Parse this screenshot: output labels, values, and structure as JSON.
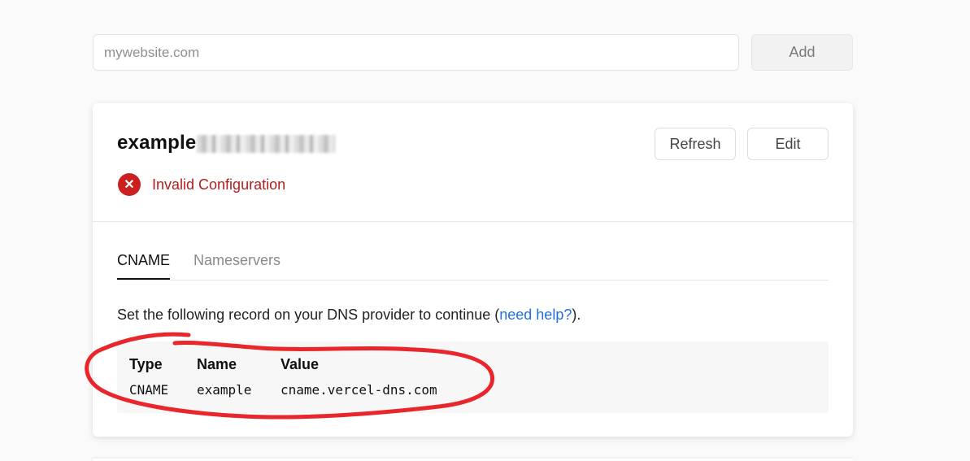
{
  "add_domain": {
    "placeholder": "mywebsite.com",
    "value": "",
    "add_label": "Add"
  },
  "domain_card": {
    "domain_prefix": "example",
    "refresh_label": "Refresh",
    "edit_label": "Edit",
    "status": {
      "icon": "x-circle-icon",
      "text": "Invalid Configuration",
      "color": "#cc1f1f"
    },
    "tabs": [
      {
        "label": "CNAME",
        "active": true
      },
      {
        "label": "Nameservers",
        "active": false
      }
    ],
    "instructions": {
      "before": "Set the following record on your DNS provider to continue (",
      "link": "need help?",
      "after": ")."
    },
    "record": {
      "headers": [
        "Type",
        "Name",
        "Value"
      ],
      "row": [
        "CNAME",
        "example",
        "cname.vercel-dns.com"
      ]
    }
  },
  "colors": {
    "link": "#1f6fe0",
    "annotation": "#e8262b"
  }
}
